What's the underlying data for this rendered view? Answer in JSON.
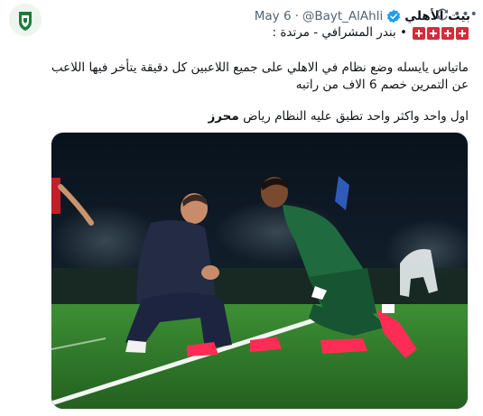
{
  "author": {
    "name": "بيت الأهلي",
    "handle": "@Bayt_AlAhli",
    "separator": "·",
    "date": "May 6",
    "avatar_icon": "club-crest-icon"
  },
  "icons": {
    "verified": "verified-badge-icon",
    "repost": "repost-icon",
    "more": "more-options-icon",
    "flag": "red-flag-icon"
  },
  "quote_attribution": "• بندر المشرافي - مرتدة :",
  "body": {
    "line1": "ماتياس يايسله وضع نظام في الاهلي على جميع اللاعبين كل دقيقة يتأخر فيها اللاعب",
    "line2": "عن التمرين خصم 6 الاف من راتبه",
    "line3_prefix": "اول واحد واكثر واحد تطبق عليه النظام رياض",
    "line3_bold": "محرز"
  },
  "colors": {
    "pitch": "#2f7a2c",
    "kit_green": "#1f6b3f",
    "boots": "#ff2d55",
    "background": "#0a1622"
  }
}
